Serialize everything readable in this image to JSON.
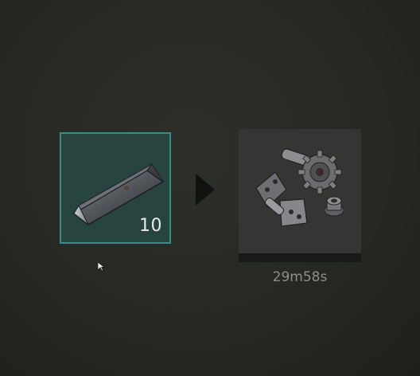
{
  "crafting": {
    "input": {
      "item_icon": "metal-fragments-icon",
      "quantity": "10"
    },
    "arrow_icon": "right-arrow-icon",
    "output": {
      "item_icon": "gears-and-hinges-icon",
      "progress": 0,
      "time_remaining": "29m58s"
    }
  },
  "colors": {
    "slot_border_active": "#3a8c86",
    "slot_fill_active": "#27443f",
    "output_slot_fill": "#343633",
    "progress_track": "#191a18",
    "timer_text": "#8c8e8a"
  }
}
